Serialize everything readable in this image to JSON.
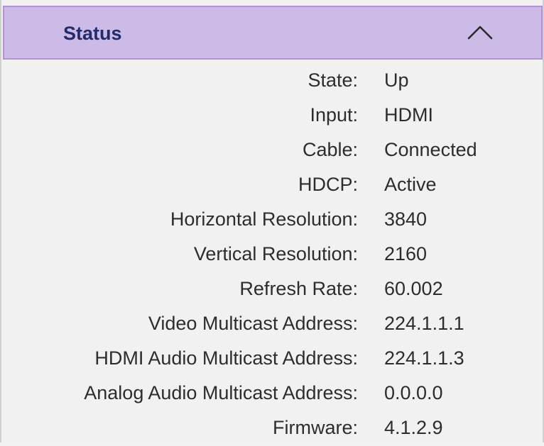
{
  "section": {
    "title": "Status",
    "collapse_icon": "chevron-up-icon"
  },
  "rows": [
    {
      "label": "State:",
      "value": "Up"
    },
    {
      "label": "Input:",
      "value": "HDMI"
    },
    {
      "label": "Cable:",
      "value": "Connected"
    },
    {
      "label": "HDCP:",
      "value": "Active"
    },
    {
      "label": "Horizontal Resolution:",
      "value": "3840"
    },
    {
      "label": "Vertical Resolution:",
      "value": "2160"
    },
    {
      "label": "Refresh Rate:",
      "value": "60.002"
    },
    {
      "label": "Video Multicast Address:",
      "value": "224.1.1.1"
    },
    {
      "label": "HDMI Audio Multicast Address:",
      "value": "224.1.1.3"
    },
    {
      "label": "Analog Audio Multicast Address:",
      "value": "0.0.0.0"
    },
    {
      "label": "Firmware:",
      "value": "4.1.2.9"
    }
  ]
}
